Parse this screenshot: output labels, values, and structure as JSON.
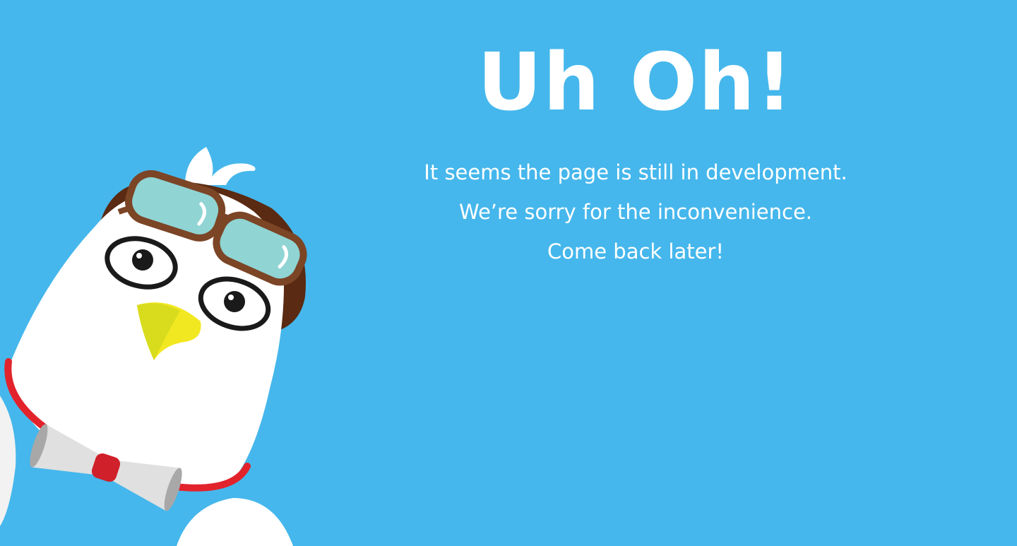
{
  "colors": {
    "background": "#45b7ec",
    "text": "#ffffff",
    "goggles_frame": "#7b4526",
    "goggles_lens": "#90d4d4",
    "hair": "#5a2a12",
    "beak": "#f2e822",
    "collar": "#e2232c",
    "megaphone": "#dcdcdc",
    "megaphone_band": "#d0202a"
  },
  "heading": "Uh Oh!",
  "message": {
    "lines": [
      "It seems the page is still in development.",
      "We’re sorry for the inconvenience.",
      "Come back later!"
    ]
  },
  "mascot": {
    "icon": "bird-mascot-with-goggles-icon"
  }
}
